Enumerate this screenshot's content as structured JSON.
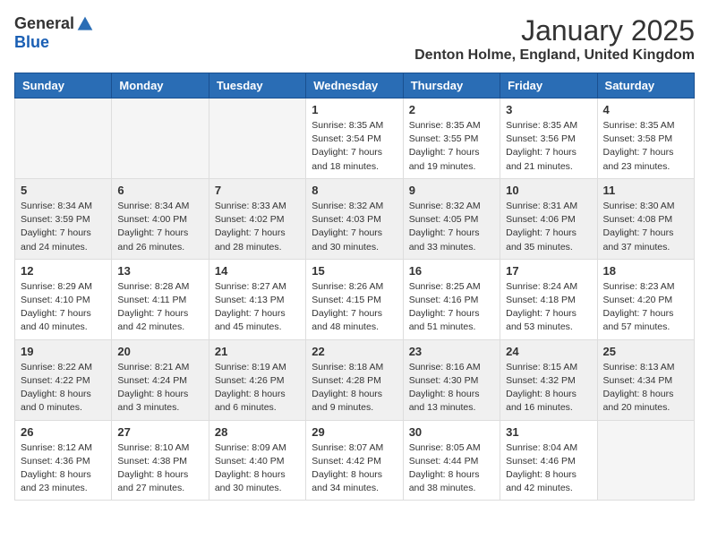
{
  "header": {
    "logo_general": "General",
    "logo_blue": "Blue",
    "month": "January 2025",
    "location": "Denton Holme, England, United Kingdom"
  },
  "days_of_week": [
    "Sunday",
    "Monday",
    "Tuesday",
    "Wednesday",
    "Thursday",
    "Friday",
    "Saturday"
  ],
  "weeks": [
    {
      "shaded": false,
      "days": [
        {
          "num": "",
          "info": ""
        },
        {
          "num": "",
          "info": ""
        },
        {
          "num": "",
          "info": ""
        },
        {
          "num": "1",
          "info": "Sunrise: 8:35 AM\nSunset: 3:54 PM\nDaylight: 7 hours\nand 18 minutes."
        },
        {
          "num": "2",
          "info": "Sunrise: 8:35 AM\nSunset: 3:55 PM\nDaylight: 7 hours\nand 19 minutes."
        },
        {
          "num": "3",
          "info": "Sunrise: 8:35 AM\nSunset: 3:56 PM\nDaylight: 7 hours\nand 21 minutes."
        },
        {
          "num": "4",
          "info": "Sunrise: 8:35 AM\nSunset: 3:58 PM\nDaylight: 7 hours\nand 23 minutes."
        }
      ]
    },
    {
      "shaded": true,
      "days": [
        {
          "num": "5",
          "info": "Sunrise: 8:34 AM\nSunset: 3:59 PM\nDaylight: 7 hours\nand 24 minutes."
        },
        {
          "num": "6",
          "info": "Sunrise: 8:34 AM\nSunset: 4:00 PM\nDaylight: 7 hours\nand 26 minutes."
        },
        {
          "num": "7",
          "info": "Sunrise: 8:33 AM\nSunset: 4:02 PM\nDaylight: 7 hours\nand 28 minutes."
        },
        {
          "num": "8",
          "info": "Sunrise: 8:32 AM\nSunset: 4:03 PM\nDaylight: 7 hours\nand 30 minutes."
        },
        {
          "num": "9",
          "info": "Sunrise: 8:32 AM\nSunset: 4:05 PM\nDaylight: 7 hours\nand 33 minutes."
        },
        {
          "num": "10",
          "info": "Sunrise: 8:31 AM\nSunset: 4:06 PM\nDaylight: 7 hours\nand 35 minutes."
        },
        {
          "num": "11",
          "info": "Sunrise: 8:30 AM\nSunset: 4:08 PM\nDaylight: 7 hours\nand 37 minutes."
        }
      ]
    },
    {
      "shaded": false,
      "days": [
        {
          "num": "12",
          "info": "Sunrise: 8:29 AM\nSunset: 4:10 PM\nDaylight: 7 hours\nand 40 minutes."
        },
        {
          "num": "13",
          "info": "Sunrise: 8:28 AM\nSunset: 4:11 PM\nDaylight: 7 hours\nand 42 minutes."
        },
        {
          "num": "14",
          "info": "Sunrise: 8:27 AM\nSunset: 4:13 PM\nDaylight: 7 hours\nand 45 minutes."
        },
        {
          "num": "15",
          "info": "Sunrise: 8:26 AM\nSunset: 4:15 PM\nDaylight: 7 hours\nand 48 minutes."
        },
        {
          "num": "16",
          "info": "Sunrise: 8:25 AM\nSunset: 4:16 PM\nDaylight: 7 hours\nand 51 minutes."
        },
        {
          "num": "17",
          "info": "Sunrise: 8:24 AM\nSunset: 4:18 PM\nDaylight: 7 hours\nand 53 minutes."
        },
        {
          "num": "18",
          "info": "Sunrise: 8:23 AM\nSunset: 4:20 PM\nDaylight: 7 hours\nand 57 minutes."
        }
      ]
    },
    {
      "shaded": true,
      "days": [
        {
          "num": "19",
          "info": "Sunrise: 8:22 AM\nSunset: 4:22 PM\nDaylight: 8 hours\nand 0 minutes."
        },
        {
          "num": "20",
          "info": "Sunrise: 8:21 AM\nSunset: 4:24 PM\nDaylight: 8 hours\nand 3 minutes."
        },
        {
          "num": "21",
          "info": "Sunrise: 8:19 AM\nSunset: 4:26 PM\nDaylight: 8 hours\nand 6 minutes."
        },
        {
          "num": "22",
          "info": "Sunrise: 8:18 AM\nSunset: 4:28 PM\nDaylight: 8 hours\nand 9 minutes."
        },
        {
          "num": "23",
          "info": "Sunrise: 8:16 AM\nSunset: 4:30 PM\nDaylight: 8 hours\nand 13 minutes."
        },
        {
          "num": "24",
          "info": "Sunrise: 8:15 AM\nSunset: 4:32 PM\nDaylight: 8 hours\nand 16 minutes."
        },
        {
          "num": "25",
          "info": "Sunrise: 8:13 AM\nSunset: 4:34 PM\nDaylight: 8 hours\nand 20 minutes."
        }
      ]
    },
    {
      "shaded": false,
      "days": [
        {
          "num": "26",
          "info": "Sunrise: 8:12 AM\nSunset: 4:36 PM\nDaylight: 8 hours\nand 23 minutes."
        },
        {
          "num": "27",
          "info": "Sunrise: 8:10 AM\nSunset: 4:38 PM\nDaylight: 8 hours\nand 27 minutes."
        },
        {
          "num": "28",
          "info": "Sunrise: 8:09 AM\nSunset: 4:40 PM\nDaylight: 8 hours\nand 30 minutes."
        },
        {
          "num": "29",
          "info": "Sunrise: 8:07 AM\nSunset: 4:42 PM\nDaylight: 8 hours\nand 34 minutes."
        },
        {
          "num": "30",
          "info": "Sunrise: 8:05 AM\nSunset: 4:44 PM\nDaylight: 8 hours\nand 38 minutes."
        },
        {
          "num": "31",
          "info": "Sunrise: 8:04 AM\nSunset: 4:46 PM\nDaylight: 8 hours\nand 42 minutes."
        },
        {
          "num": "",
          "info": ""
        }
      ]
    }
  ]
}
